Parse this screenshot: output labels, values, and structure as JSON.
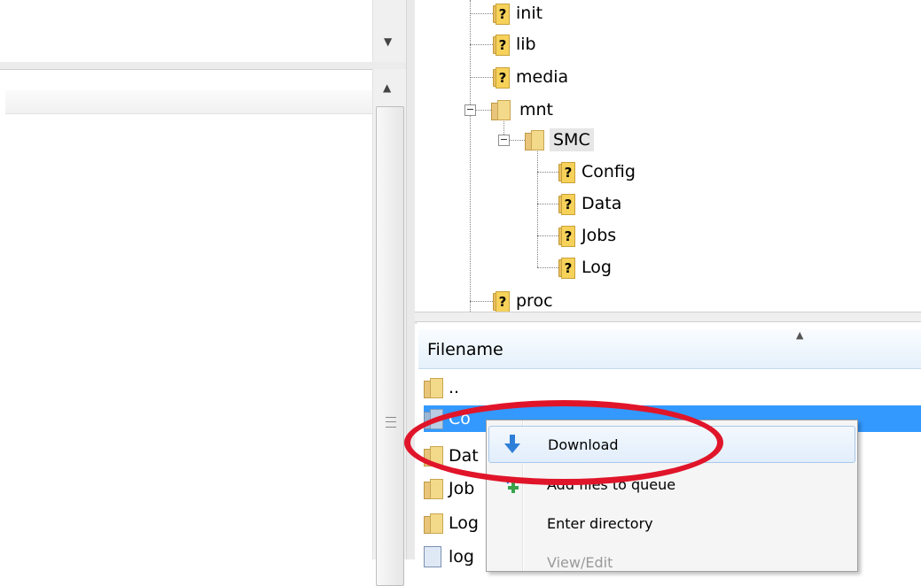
{
  "tree": {
    "items": [
      {
        "label": "init"
      },
      {
        "label": "lib"
      },
      {
        "label": "media"
      },
      {
        "label": "mnt",
        "expanded": true
      },
      {
        "label": "SMC",
        "expanded": true,
        "selected": true
      },
      {
        "label": "Config"
      },
      {
        "label": "Data"
      },
      {
        "label": "Jobs"
      },
      {
        "label": "Log"
      },
      {
        "label": "proc"
      }
    ],
    "collapse_symbol": "−"
  },
  "file_list": {
    "header": "Filename",
    "rows": [
      {
        "name": ".."
      },
      {
        "name": "Config",
        "visible_text": "Co",
        "selected": true
      },
      {
        "name": "Data",
        "visible_text": "Dat"
      },
      {
        "name": "Jobs",
        "visible_text": "Job"
      },
      {
        "name": "Log",
        "visible_text": "Log"
      },
      {
        "name": "log",
        "visible_text": "log"
      }
    ]
  },
  "context_menu": {
    "items": [
      {
        "label": "Download",
        "icon": "download-arrow-icon",
        "highlighted": true
      },
      {
        "label": "Add files to queue",
        "icon": "add-to-queue-icon"
      },
      {
        "label": "Enter directory"
      },
      {
        "label": "View/Edit",
        "disabled": true
      }
    ]
  },
  "colors": {
    "selection": "#3399ff",
    "annotation": "#e0152a",
    "menu_highlight_border": "#a9c8ea"
  }
}
